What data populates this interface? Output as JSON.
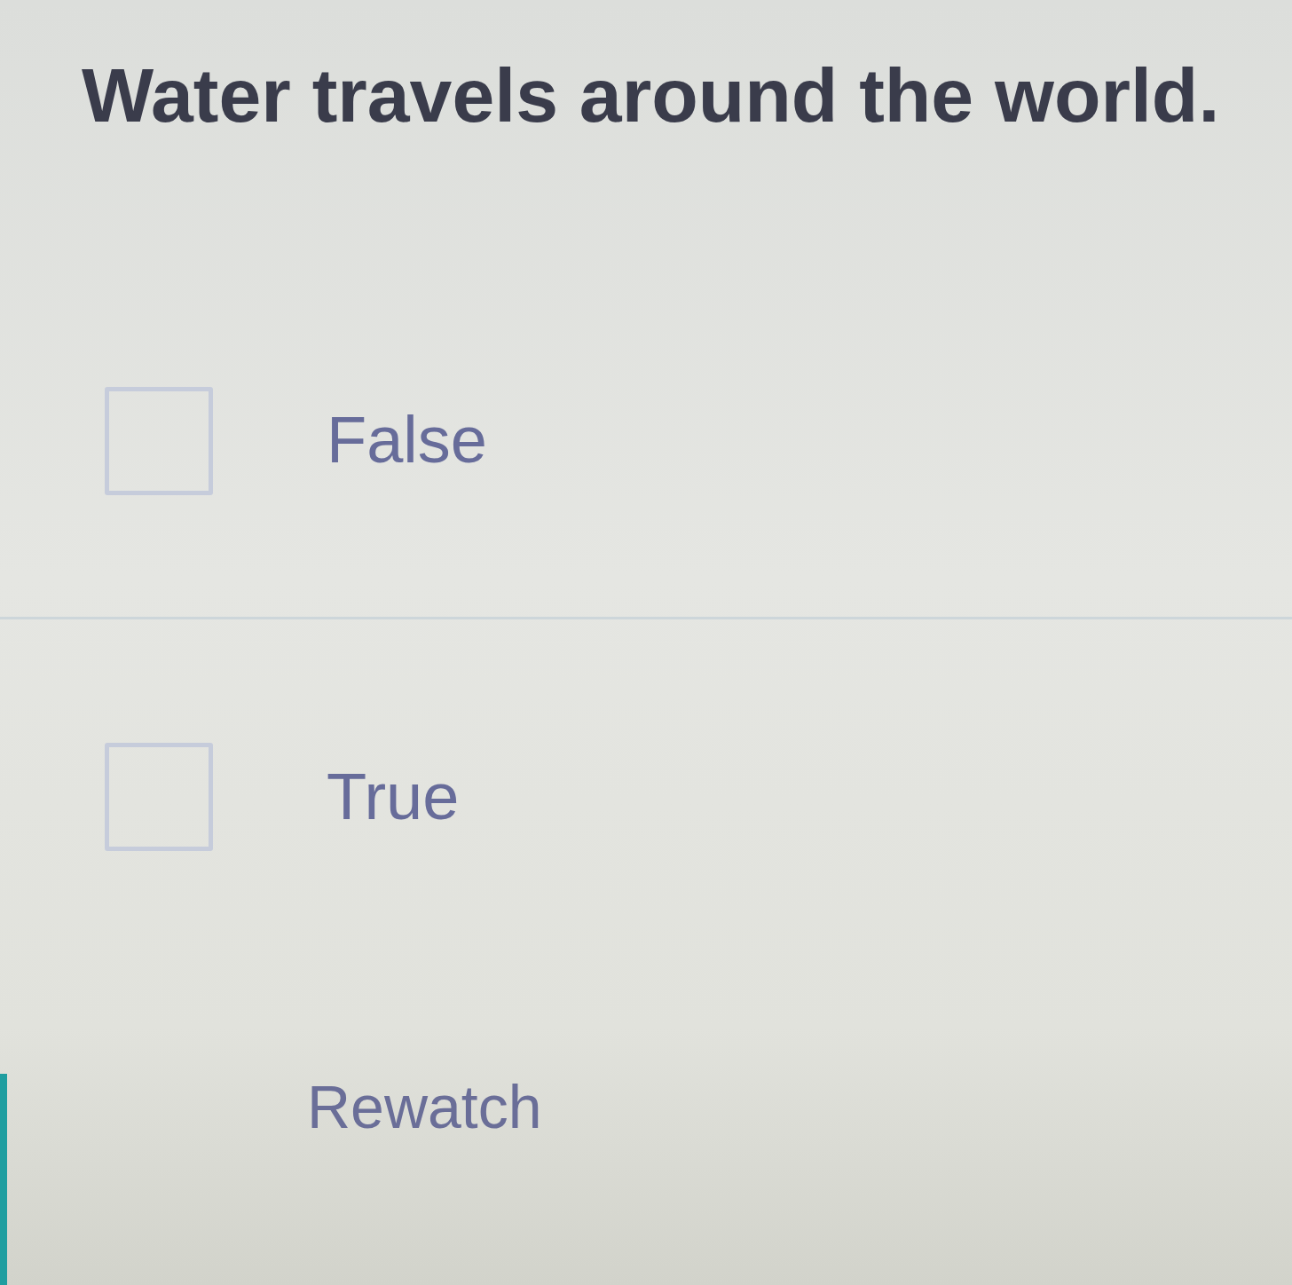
{
  "question": {
    "text": "Water travels around the world."
  },
  "options": [
    {
      "label": "False",
      "checked": false
    },
    {
      "label": "True",
      "checked": false
    }
  ],
  "rewatch_button": {
    "label": "Rewatch"
  }
}
